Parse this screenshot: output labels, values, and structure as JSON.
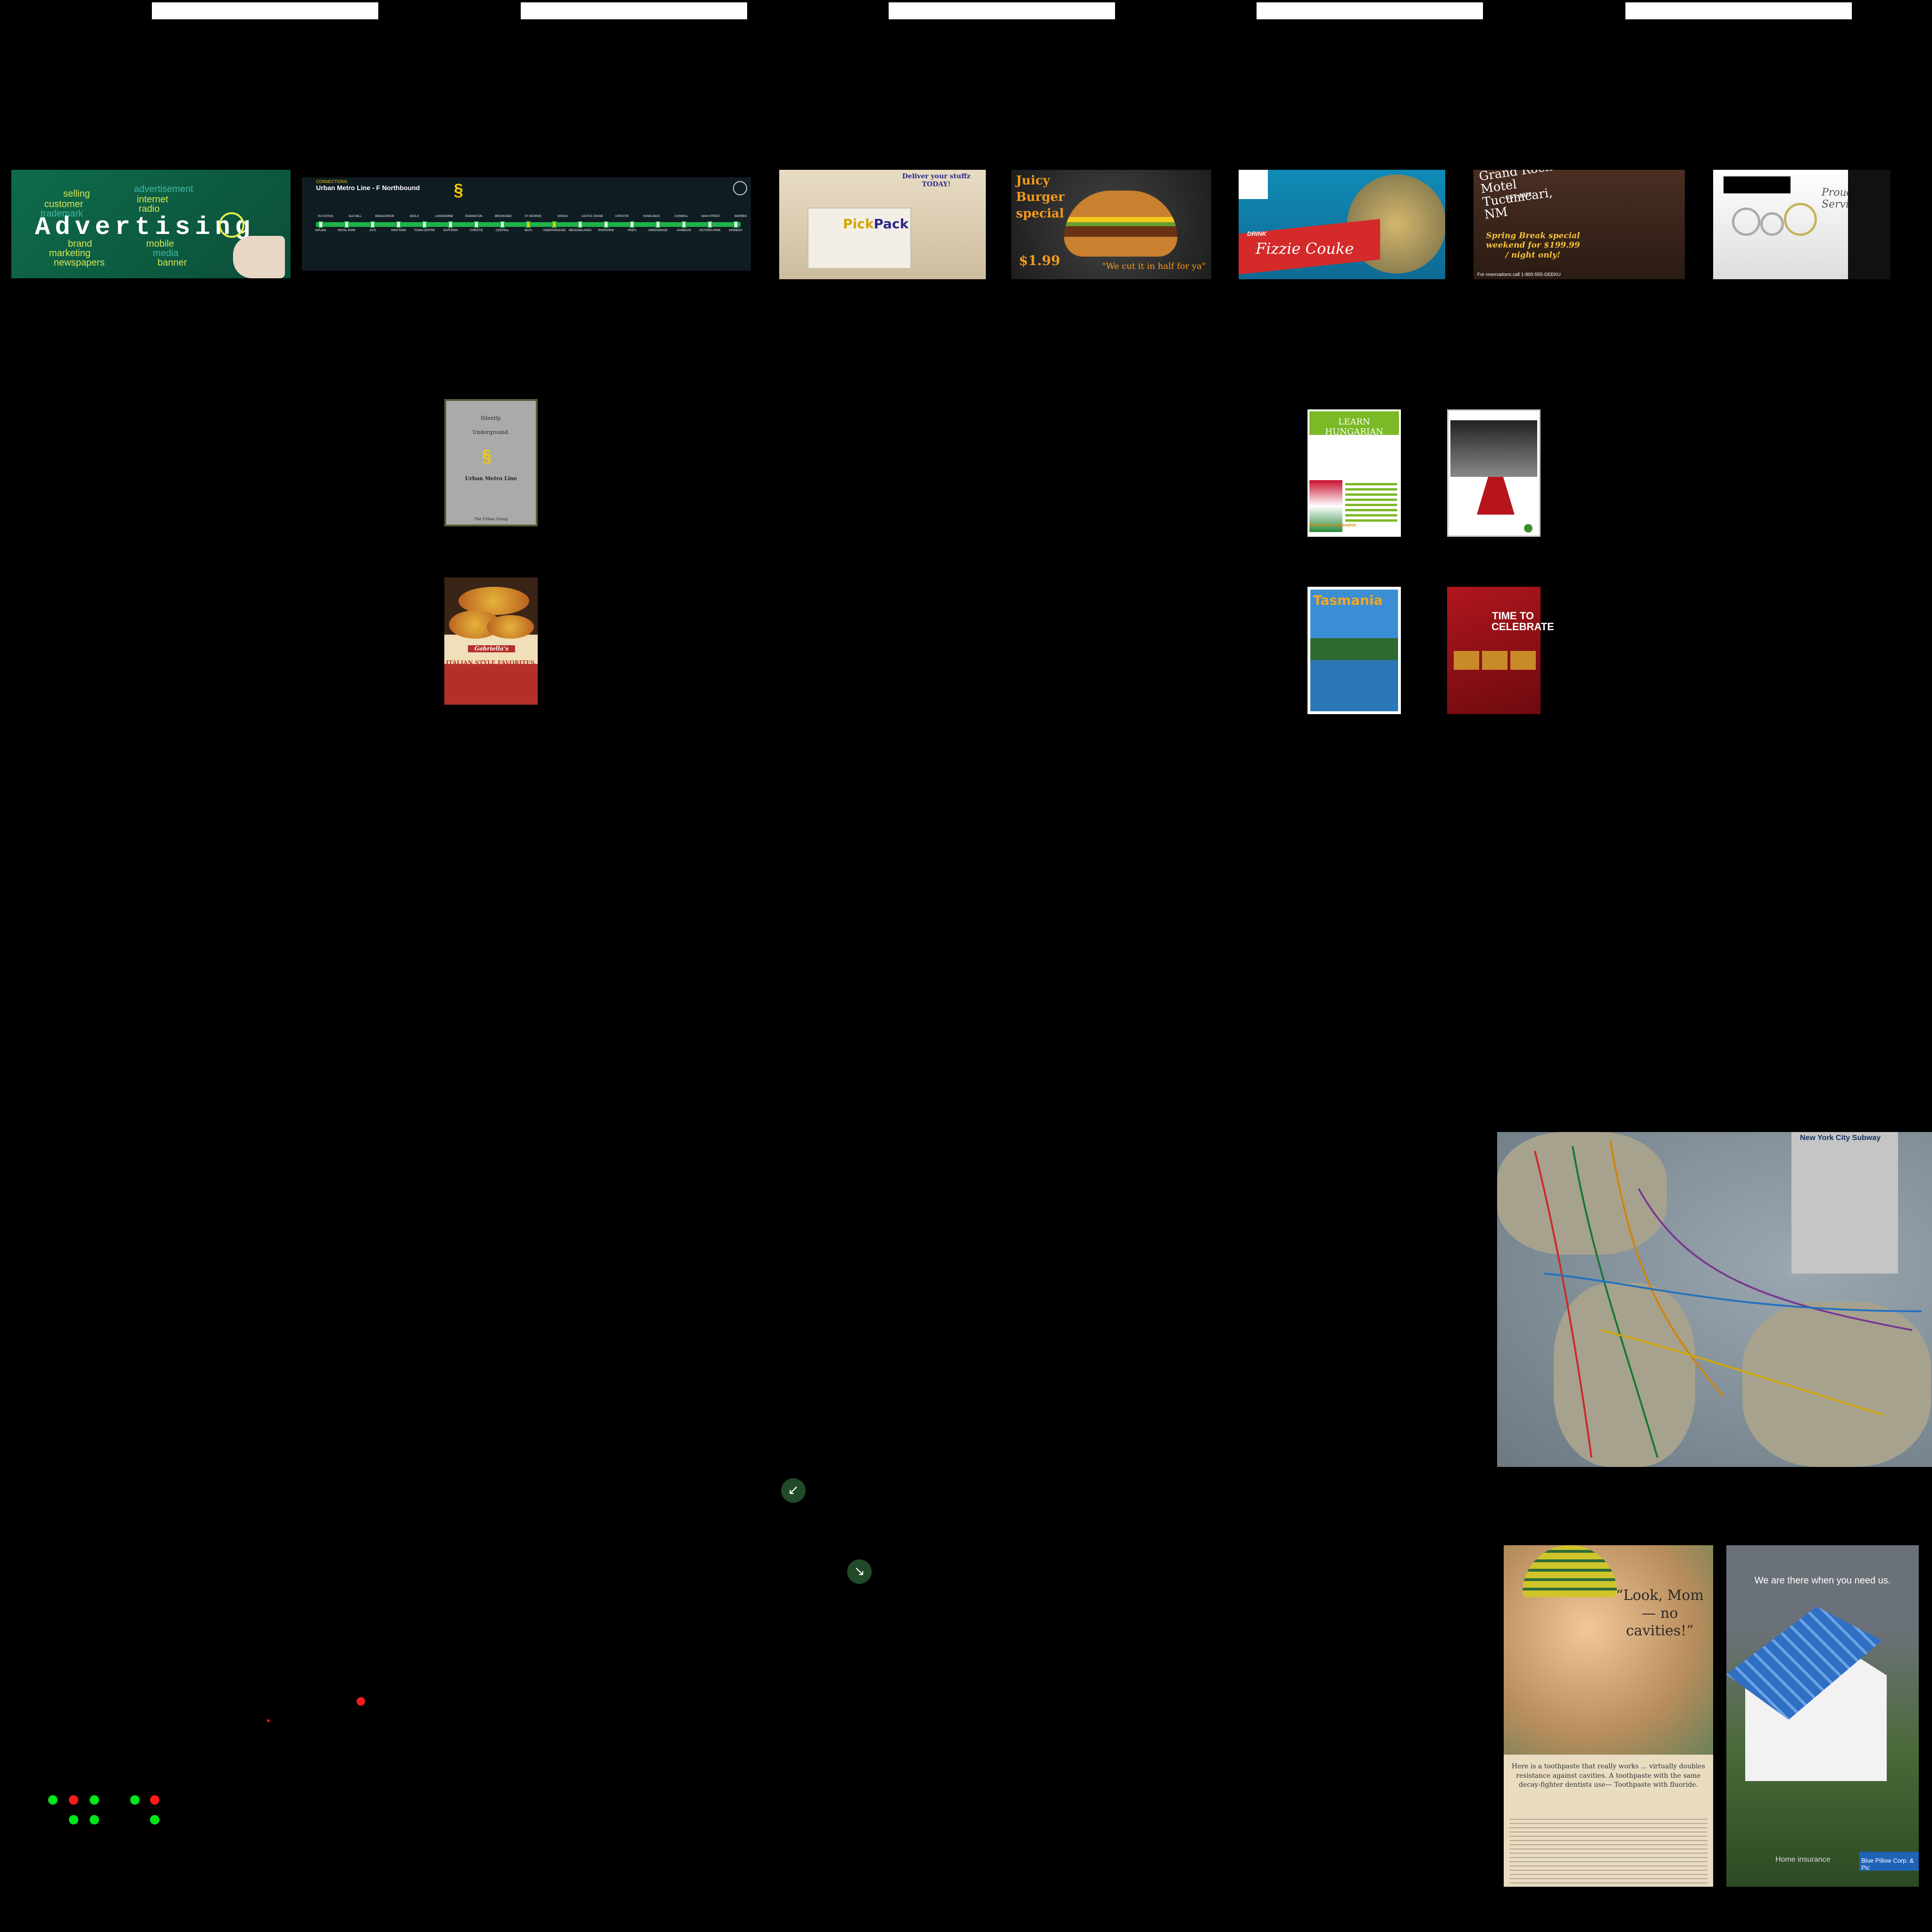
{
  "top_tabs": [
    "",
    "",
    "",
    "",
    ""
  ],
  "advertising": {
    "headline": "Advertising",
    "words": [
      "selling",
      "customer",
      "trademark",
      "brand",
      "marketing",
      "newspapers",
      "advertisement",
      "internet",
      "radio",
      "mobile",
      "media",
      "banner"
    ]
  },
  "metro_banner": {
    "connections_label": "CONNECTIONS",
    "line_title": "Urban Metro Line - F Northbound",
    "stations_top": [
      "SILTASTON",
      "OLD MILL",
      "MONACHIEDE",
      "KEELS",
      "LANSDOWNE",
      "EDDINGTON",
      "BROOKSIDE",
      "ST GEORGE",
      "GENOA",
      "CASTLE CRANE",
      "CHESTER",
      "HOWLANDS",
      "COSWELL",
      "MAIN STREET",
      "WARREN"
    ],
    "stations_bottom": [
      "KIPLING",
      "ROYAL PARK",
      "JAYS",
      "HIGH PARK",
      "TOWN CENTRE",
      "DUFFERIN",
      "CHRISTIE",
      "CENTRAL",
      "BAYS",
      "UNDERGROUND",
      "MEADOWLANDS",
      "RIVERVIEW",
      "PINES",
      "GREENWOOD",
      "HARBOUR",
      "VICTORIA PARK",
      "KENNEDY"
    ]
  },
  "pickpack": {
    "tagline": "Deliver your stuffz TODAY!",
    "brand_pick": "Pick",
    "brand_pack": "Pack"
  },
  "burger": {
    "headline": "Juicy Burger special",
    "price": "$1.99",
    "slogan": "\"We cut it in half for ya\""
  },
  "fizzie": {
    "drink_label": "DRINK",
    "brand": "Fizzie Couke"
  },
  "motel": {
    "name": "Grand Rock Motel Tucumcari, NM",
    "established": "EST. 1922",
    "offer": "Spring Break special weekend for $199.99 / night only!",
    "reservations": "For reservations call 1-800-555-GEEKU"
  },
  "jewelry": {
    "script": "Proudly Serving"
  },
  "silently": {
    "line1": "Silently.",
    "line2": "Underground.",
    "brand": "Urban Metro Line",
    "footer": "The Urban Group"
  },
  "pizza": {
    "brand": "Gabriella's",
    "text": "ITALIAN STYLE FAVORITES. TOPPINGS or DRESSED UP FOR DELIVERY."
  },
  "hungarian": {
    "header": "LEARN HUNGARIAN",
    "price": "€135 hours preparation"
  },
  "tasmania": {
    "name": "Tasmania"
  },
  "celebrate": {
    "headline": "TIME TO CELEBRATE"
  },
  "subway_map": {
    "title": "New York City Subway"
  },
  "toothpaste": {
    "quote": "“Look, Mom— no cavities!”",
    "body": "Here is a toothpaste that really works ... virtually doubles resistance against cavities. A toothpaste with the same decay-fighter dentists use— Toothpaste with fluoride."
  },
  "insurance": {
    "tagline": "We are there when you need us.",
    "product": "Home insurance",
    "corp": "Blue Pillow Corp. & Pic"
  },
  "colors": {
    "background": "#000000",
    "dot_green": "#00e61a",
    "dot_red": "#ff1a1a",
    "arrow_bg": "#214a28"
  },
  "icons": {
    "arrow_sw": "arrow-down-left-icon",
    "arrow_se": "arrow-down-right-icon"
  }
}
